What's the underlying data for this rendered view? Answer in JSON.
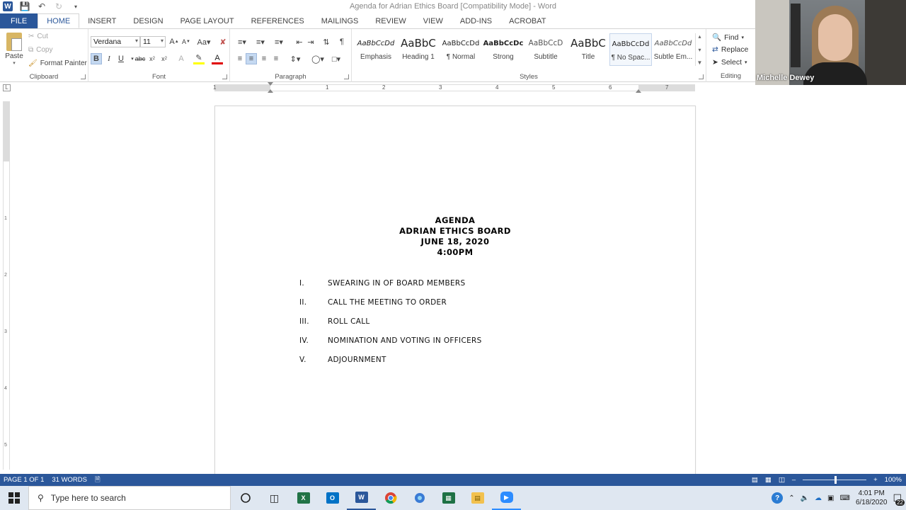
{
  "window": {
    "title": "Agenda for Adrian Ethics Board [Compatibility Mode] - Word"
  },
  "tabs": [
    {
      "label": "FILE"
    },
    {
      "label": "HOME"
    },
    {
      "label": "INSERT"
    },
    {
      "label": "DESIGN"
    },
    {
      "label": "PAGE LAYOUT"
    },
    {
      "label": "REFERENCES"
    },
    {
      "label": "MAILINGS"
    },
    {
      "label": "REVIEW"
    },
    {
      "label": "VIEW"
    },
    {
      "label": "ADD-INS"
    },
    {
      "label": "ACROBAT"
    }
  ],
  "clipboard": {
    "paste": "Paste",
    "cut": "Cut",
    "copy": "Copy",
    "format_painter": "Format Painter",
    "label": "Clipboard"
  },
  "font": {
    "name": "Verdana",
    "size": "11",
    "label": "Font"
  },
  "paragraph": {
    "label": "Paragraph"
  },
  "styles": {
    "label": "Styles",
    "items": [
      {
        "sample": "AaBbCcDd",
        "name": "Emphasis"
      },
      {
        "sample": "AaBbC",
        "name": "Heading 1"
      },
      {
        "sample": "AaBbCcDd",
        "name": "¶ Normal"
      },
      {
        "sample": "AaBbCcDc",
        "name": "Strong"
      },
      {
        "sample": "AaBbCcD",
        "name": "Subtitle"
      },
      {
        "sample": "AaBbC",
        "name": "Title"
      },
      {
        "sample": "AaBbCcDd",
        "name": "¶ No Spac..."
      },
      {
        "sample": "AaBbCcDd",
        "name": "Subtle Em..."
      }
    ]
  },
  "editing": {
    "find": "Find",
    "replace": "Replace",
    "select": "Select",
    "label": "Editing"
  },
  "ruler": {
    "numbers": [
      "1",
      "1",
      "2",
      "3",
      "4",
      "5",
      "6",
      "7"
    ]
  },
  "vruler": {
    "numbers": [
      "1",
      "2",
      "3",
      "4",
      "5"
    ]
  },
  "document": {
    "heading": [
      "AGENDA",
      "ADRIAN ETHICS BOARD",
      "JUNE 18, 2020",
      "4:00PM"
    ],
    "items": [
      {
        "num": "I.",
        "text": "SWEARING IN OF BOARD MEMBERS"
      },
      {
        "num": "II.",
        "text": "CALL THE MEETING TO ORDER"
      },
      {
        "num": "III.",
        "text": "ROLL CALL"
      },
      {
        "num": "IV.",
        "text": "NOMINATION AND VOTING IN OFFICERS"
      },
      {
        "num": "V.",
        "text": "ADJOURNMENT"
      }
    ]
  },
  "webcam": {
    "name": "Michelle Dewey"
  },
  "status": {
    "page": "PAGE 1 OF 1",
    "words": "31 WORDS",
    "zoom": "100%",
    "zoom_level_percent": 100
  },
  "taskbar": {
    "search_placeholder": "Type here to search",
    "time": "4:01 PM",
    "date": "6/18/2020",
    "notifications": "22"
  },
  "colors": {
    "accent": "#2b579a",
    "taskbar": "#dfe7f1"
  }
}
